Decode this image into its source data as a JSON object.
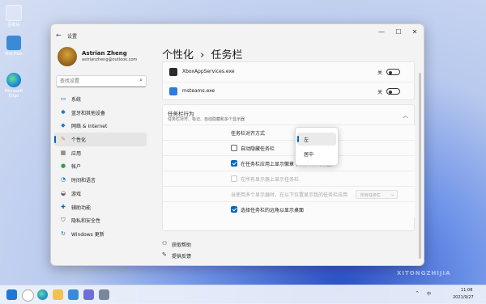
{
  "desktop": {
    "icons": [
      {
        "label": "回收站",
        "icon": "recycle-bin-icon"
      },
      {
        "label": "Mid Files",
        "icon": "folder-icon"
      },
      {
        "label": "Microsoft Edge",
        "icon": "edge-icon"
      }
    ]
  },
  "window": {
    "title": "设置",
    "controls": {
      "minimize": "—",
      "maximize": "☐",
      "close": "✕"
    }
  },
  "profile": {
    "name": "Astrian Zheng",
    "email": "astrianzheng@outlook.com"
  },
  "search": {
    "placeholder": "查找设置"
  },
  "sidebar": {
    "items": [
      {
        "label": "系统",
        "icon": "monitor-icon",
        "color": "#0067c0"
      },
      {
        "label": "蓝牙和其他设备",
        "icon": "bluetooth-icon",
        "color": "#0067c0"
      },
      {
        "label": "网络 & Internet",
        "icon": "wifi-icon",
        "color": "#2d6fce"
      },
      {
        "label": "个性化",
        "icon": "brush-icon",
        "color": "#e08a3c"
      },
      {
        "label": "应用",
        "icon": "apps-icon",
        "color": "#555555"
      },
      {
        "label": "帐户",
        "icon": "person-icon",
        "color": "#2ea043"
      },
      {
        "label": "时间和语言",
        "icon": "globe-clock-icon",
        "color": "#0067c0"
      },
      {
        "label": "游戏",
        "icon": "gamepad-icon",
        "color": "#555555"
      },
      {
        "label": "辅助功能",
        "icon": "accessibility-icon",
        "color": "#0067c0"
      },
      {
        "label": "隐私和安全性",
        "icon": "shield-icon",
        "color": "#555555"
      },
      {
        "label": "Windows 更新",
        "icon": "update-icon",
        "color": "#0067c0"
      }
    ],
    "selected_index": 3
  },
  "breadcrumb": {
    "parent": "个性化",
    "separator": "›",
    "current": "任务栏"
  },
  "overflow_apps": [
    {
      "label": "XboxAppServices.exe",
      "state": "关",
      "icon": "xbox-app-icon"
    },
    {
      "label": "msteams.exe",
      "state": "关",
      "icon": "teams-icon"
    }
  ],
  "behaviors": {
    "title": "任务栏行为",
    "subtitle": "任务栏对齐、标记、自动隐藏和多个显示器",
    "expanded": true,
    "alignment_label": "任务栏对齐方式",
    "rows": [
      {
        "label": "自动隐藏任务栏",
        "checked": false,
        "disabled": false
      },
      {
        "label": "在任务栏应用上显示徽章 (未读邮件计数器)",
        "checked": true,
        "disabled": false
      },
      {
        "label": "在所有显示器上显示任务栏",
        "checked": false,
        "disabled": true
      }
    ],
    "multi_monitor": {
      "label": "当使用多个显示器时，在以下位置显示我的任务栏应用",
      "value": "所有任务栏"
    },
    "corner_row": {
      "label": "选择任务栏的远角以显示桌面",
      "checked": true
    }
  },
  "alignment_menu": {
    "options": [
      "左",
      "居中"
    ],
    "selected_index": 0
  },
  "help": {
    "get_help": "获取帮助",
    "feedback": "提供反馈"
  },
  "taskbar": {
    "icons": [
      "start-icon",
      "search-icon",
      "edge-icon",
      "file-explorer-icon",
      "store-icon",
      "teams-chat-icon",
      "settings-icon"
    ],
    "tray": {
      "time": "11:08",
      "date": "2021/9/27",
      "chevron": "^",
      "lang": "中"
    }
  },
  "watermark": "XITONGZHIJIA"
}
